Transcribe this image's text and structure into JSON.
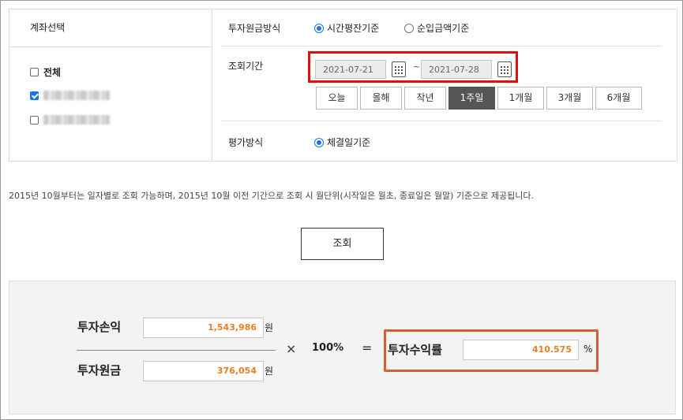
{
  "account": {
    "header": "계좌선택",
    "all_label": "전체",
    "items": [
      {
        "checked": true
      },
      {
        "checked": false
      }
    ]
  },
  "principal_method": {
    "label": "투자원금방식",
    "options": [
      "시간평잔기준",
      "순입금액기준"
    ],
    "selected": "시간평잔기준"
  },
  "period": {
    "label": "조회기간",
    "start": "2021-07-21",
    "end": "2021-07-28",
    "separator": "~",
    "buttons": [
      "오늘",
      "올해",
      "작년",
      "1주일",
      "1개월",
      "3개월",
      "6개월"
    ],
    "selected": "1주일"
  },
  "eval_method": {
    "label": "평가방식",
    "option": "체결일기준"
  },
  "notice": "2015년 10월부터는 일자별로 조회 가능하며, 2015년 10월 이전 기간으로 조회 시 월단위(시작일은 월초, 종료일은 월말) 기준으로 제공됩니다.",
  "query_button": "조회",
  "result": {
    "pnl_label": "투자손익",
    "pnl_value": "1,543,986",
    "principal_label": "투자원금",
    "principal_value": "376,054",
    "won": "원",
    "times": "×",
    "percent": "100%",
    "equals": "=",
    "rate_label": "투자수익률",
    "rate_value": "410.575",
    "rate_unit": "%"
  },
  "colors": {
    "highlight_red": "#e10f0f",
    "highlight_orange": "#d35f3a",
    "value_orange": "#e67e22",
    "selected_button": "#555555",
    "radio_blue": "#1a73e8"
  }
}
